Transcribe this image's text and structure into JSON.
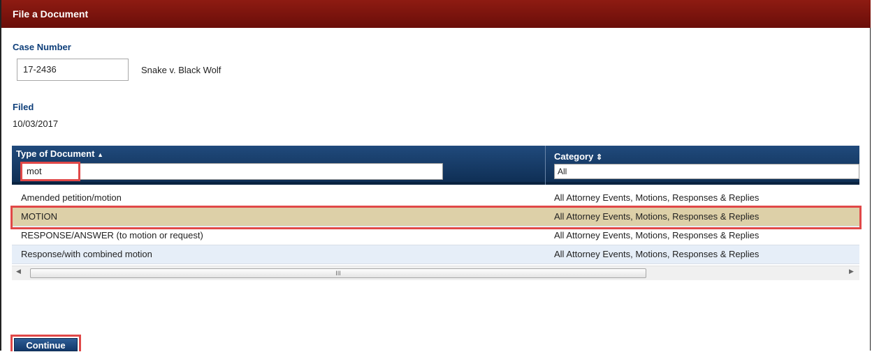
{
  "panel": {
    "title": "File a Document"
  },
  "case": {
    "label": "Case Number",
    "number": "17-2436",
    "caption": "Snake v. Black Wolf"
  },
  "filed": {
    "label": "Filed",
    "date": "10/03/2017"
  },
  "grid": {
    "columns": [
      {
        "label": "Type of Document",
        "sort_icon": "▲",
        "filter_value": "mot"
      },
      {
        "label": "Category",
        "sort_icon": "⇕",
        "filter_value": "All"
      }
    ],
    "rows": [
      {
        "type": "Amended petition/motion",
        "category": "All Attorney Events, Motions, Responses & Replies"
      },
      {
        "type": "MOTION",
        "category": "All Attorney Events, Motions, Responses & Replies"
      },
      {
        "type": "RESPONSE/ANSWER (to motion or request)",
        "category": "All Attorney Events, Motions, Responses & Replies"
      },
      {
        "type": "Response/with combined motion",
        "category": "All Attorney Events, Motions, Responses & Replies"
      }
    ],
    "selected_row": 1,
    "scrollbar": {
      "left": "◀",
      "right": "▶",
      "grip": "III"
    }
  },
  "actions": {
    "continue_label": "Continue"
  },
  "colors": {
    "title_bar": "#7a130d",
    "header": "#163a66",
    "selected_row": "#ddd0a8",
    "alt_row": "#e6eef8",
    "highlight": "#e04848"
  }
}
